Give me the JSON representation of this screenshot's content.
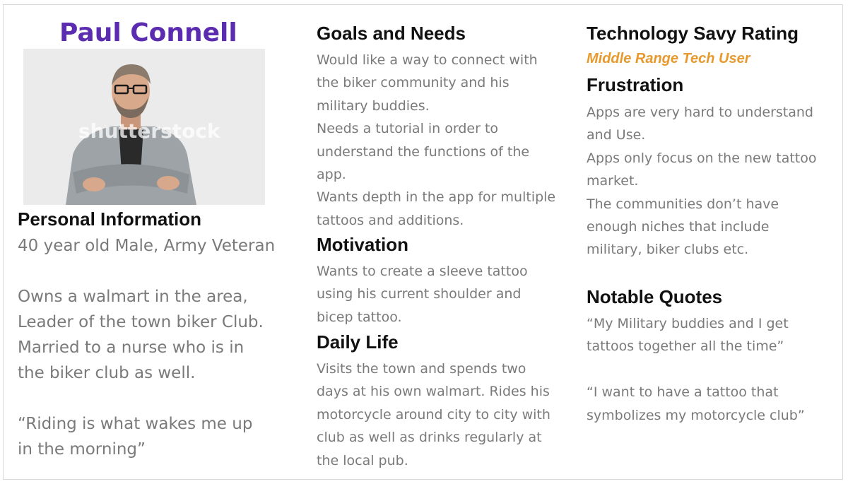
{
  "persona": {
    "name": "Paul Connell",
    "photo_watermark": "shutterstock"
  },
  "personal_information": {
    "heading": "Personal Information",
    "lines": [
      "40 year old Male, Army Veteran",
      "",
      "Owns a walmart in the area,",
      "Leader of the town biker Club.",
      "Married to a nurse who is in",
      "the biker club as well.",
      "",
      "“Riding is what wakes me up",
      "in the morning”"
    ]
  },
  "goals_and_needs": {
    "heading": "Goals and Needs",
    "lines": [
      "Would like a way to connect with",
      "the biker community and his",
      "military buddies.",
      "Needs a tutorial  in order to",
      "understand the functions of the",
      "app.",
      "Wants depth in the app for multiple",
      "tattoos and additions."
    ]
  },
  "motivation": {
    "heading": "Motivation",
    "lines": [
      "Wants to create a sleeve tattoo",
      "using his current shoulder and",
      "bicep tattoo."
    ]
  },
  "daily_life": {
    "heading": "Daily Life",
    "lines": [
      "Visits the town and spends two",
      "days at his own walmart. Rides his",
      "motorcycle around city to city with",
      "club as well as drinks regularly at",
      "the local pub."
    ]
  },
  "technology": {
    "heading": "Technology Savy Rating",
    "rating": "Middle Range Tech User"
  },
  "frustration": {
    "heading": "Frustration",
    "lines": [
      "Apps are very hard to understand",
      "and Use.",
      "Apps only focus on the new tattoo",
      "market.",
      "The communities don’t have",
      "enough niches that include",
      "military, biker clubs etc."
    ]
  },
  "notable_quotes": {
    "heading": "Notable Quotes",
    "lines": [
      "“My Military buddies and I get",
      "tattoos together all the time”",
      "",
      "“I want to have a tattoo that",
      "symbolizes my motorcycle club”"
    ]
  },
  "colors": {
    "name": "#5b2bb0",
    "rating": "#e8992e",
    "heading": "#111111",
    "body": "#7a7a7a"
  }
}
